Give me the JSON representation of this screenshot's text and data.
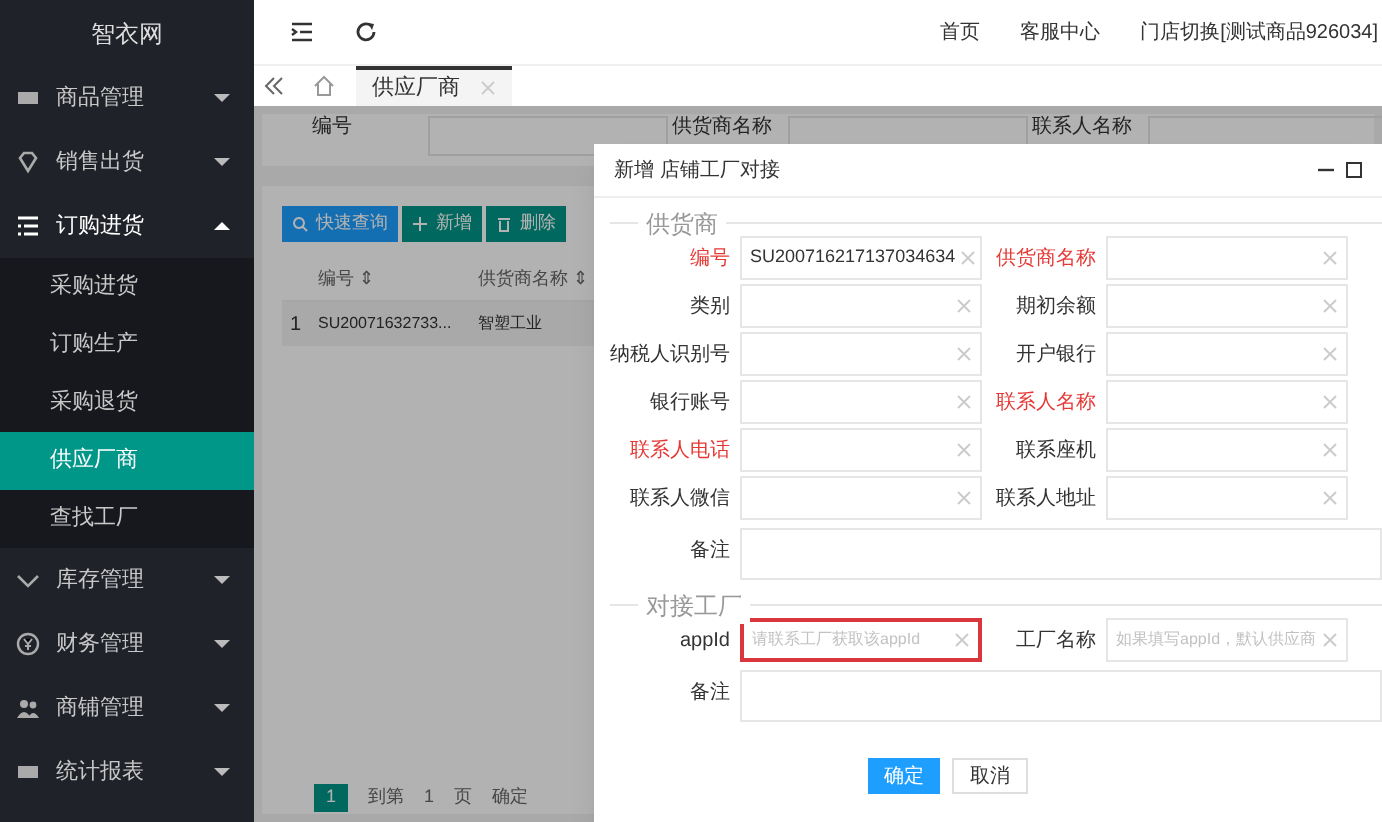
{
  "sidebar": {
    "logo": "智衣网",
    "items": [
      {
        "label": "商品管理",
        "expanded": false
      },
      {
        "label": "销售出货",
        "expanded": false
      },
      {
        "label": "订购进货",
        "expanded": true,
        "children": [
          {
            "label": "采购进货",
            "selected": false
          },
          {
            "label": "订购生产",
            "selected": false
          },
          {
            "label": "采购退货",
            "selected": false
          },
          {
            "label": "供应厂商",
            "selected": true
          },
          {
            "label": "查找工厂",
            "selected": false
          }
        ]
      },
      {
        "label": "库存管理",
        "expanded": false
      },
      {
        "label": "财务管理",
        "expanded": false
      },
      {
        "label": "商铺管理",
        "expanded": false
      },
      {
        "label": "统计报表",
        "expanded": false
      }
    ]
  },
  "topbar": {
    "links": [
      "首页",
      "客服中心",
      "门店切换[测试商品926034]"
    ]
  },
  "tabs": [
    {
      "label": "供应厂商",
      "selected": true
    }
  ],
  "background": {
    "search_labels": [
      "编号",
      "供货商名称",
      "联系人名称"
    ],
    "toolbar": [
      {
        "label": "快速查询",
        "kind": "search"
      },
      {
        "label": "新增",
        "kind": "add"
      },
      {
        "label": "删除",
        "kind": "delete"
      }
    ],
    "columns": [
      "编号 ⇕",
      "供货商名称 ⇕"
    ],
    "rows": [
      {
        "index": "1",
        "cells": [
          "SU20071632733...",
          "智塑工业"
        ]
      }
    ],
    "pagination": [
      "1",
      "到第",
      "1",
      "页",
      "确定"
    ]
  },
  "dialog": {
    "title": "新增 店铺工厂对接",
    "sections": [
      {
        "legend": "供货商",
        "fields": [
          {
            "label": "编号",
            "value": "SU200716217137034634",
            "required": true
          },
          {
            "label": "供货商名称",
            "required": true
          },
          {
            "label": "类别",
            "required": false
          },
          {
            "label": "期初余额",
            "required": false
          },
          {
            "label": "纳税人识别号",
            "required": false
          },
          {
            "label": "开户银行",
            "required": false
          },
          {
            "label": "银行账号",
            "required": false
          },
          {
            "label": "联系人名称",
            "required": true
          },
          {
            "label": "联系人电话",
            "required": true
          },
          {
            "label": "联系座机",
            "required": false
          },
          {
            "label": "联系人微信",
            "required": false
          },
          {
            "label": "联系人地址",
            "required": false
          }
        ],
        "note_label": "备注"
      },
      {
        "legend": "对接工厂",
        "fields": [
          {
            "label": "appId",
            "placeholder": "请联系工厂获取该appId",
            "required": false,
            "highlighted": true
          },
          {
            "label": "工厂名称",
            "placeholder": "如果填写appId，默认供应商",
            "required": false,
            "highlighted": false
          }
        ],
        "note_label": "备注"
      }
    ],
    "buttons": [
      {
        "label": "确定",
        "kind": "primary"
      },
      {
        "label": "取消",
        "kind": "default"
      }
    ]
  }
}
